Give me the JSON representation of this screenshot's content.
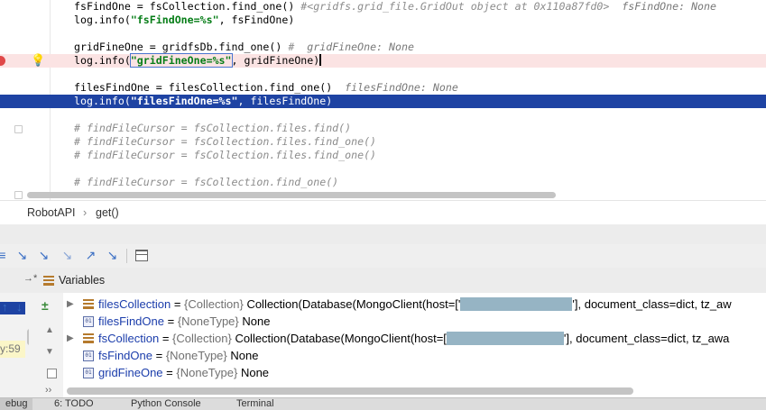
{
  "editor": {
    "lines": [
      {
        "code": "fsFindOne = fsCollection.find_one()",
        "comment": "#<gridfs.grid_file.GridOut object at 0x110a87fd0>",
        "hint": "fsFindOne: None"
      },
      {
        "pre": "log.info(",
        "str": "\"fsFindOne=%s\"",
        "post": ", fsFindOne)"
      },
      {
        "code": "gridFineOne = gridfsDb.find_one()",
        "comment": "#",
        "hint": "gridFineOne: None"
      },
      {
        "pre": "log.info(",
        "str": "\"gridFineOne=%s\"",
        "post": ", gridFineOne)"
      },
      {
        "code": "filesFindOne = filesCollection.find_one()",
        "hint": "filesFindOne: None"
      },
      {
        "pre": "log.info(",
        "str": "\"filesFindOne=%s\"",
        "post": ", filesFindOne)"
      },
      {
        "comment": "# findFileCursor = fsCollection.files.find()"
      },
      {
        "comment": "# findFileCursor = fsCollection.files.find_one()"
      },
      {
        "comment": "# findFileCursor = fsCollection.files.find_one()"
      },
      {
        "comment": "# findFileCursor = fsCollection.find_one()"
      }
    ]
  },
  "breadcrumb": {
    "class": "RobotAPI",
    "sep": "›",
    "method": "get()"
  },
  "debug": {
    "variables_label": "Variables",
    "side_text": "y:59",
    "vars": [
      {
        "name": "filesCollection",
        "eq": " = ",
        "type": "{Collection}",
        "value_pre": "Collection(Database(MongoClient(host=['",
        "value_post": "'], document_class=dict, tz_aw"
      },
      {
        "name": "filesFindOne",
        "eq": " = ",
        "type": "{NoneType}",
        "value": "None"
      },
      {
        "name": "fsCollection",
        "eq": " = ",
        "type": "{Collection}",
        "value_pre": "Collection(Database(MongoClient(host=[",
        "value_post": "'], document_class=dict, tz_awa"
      },
      {
        "name": "fsFindOne",
        "eq": " = ",
        "type": "{NoneType}",
        "value": "None"
      },
      {
        "name": "gridFineOne",
        "eq": " = ",
        "type": "{NoneType}",
        "value": "None"
      }
    ]
  },
  "bottom_tabs": [
    "ebug",
    "6: TODO",
    "Python Console",
    "Terminal"
  ]
}
